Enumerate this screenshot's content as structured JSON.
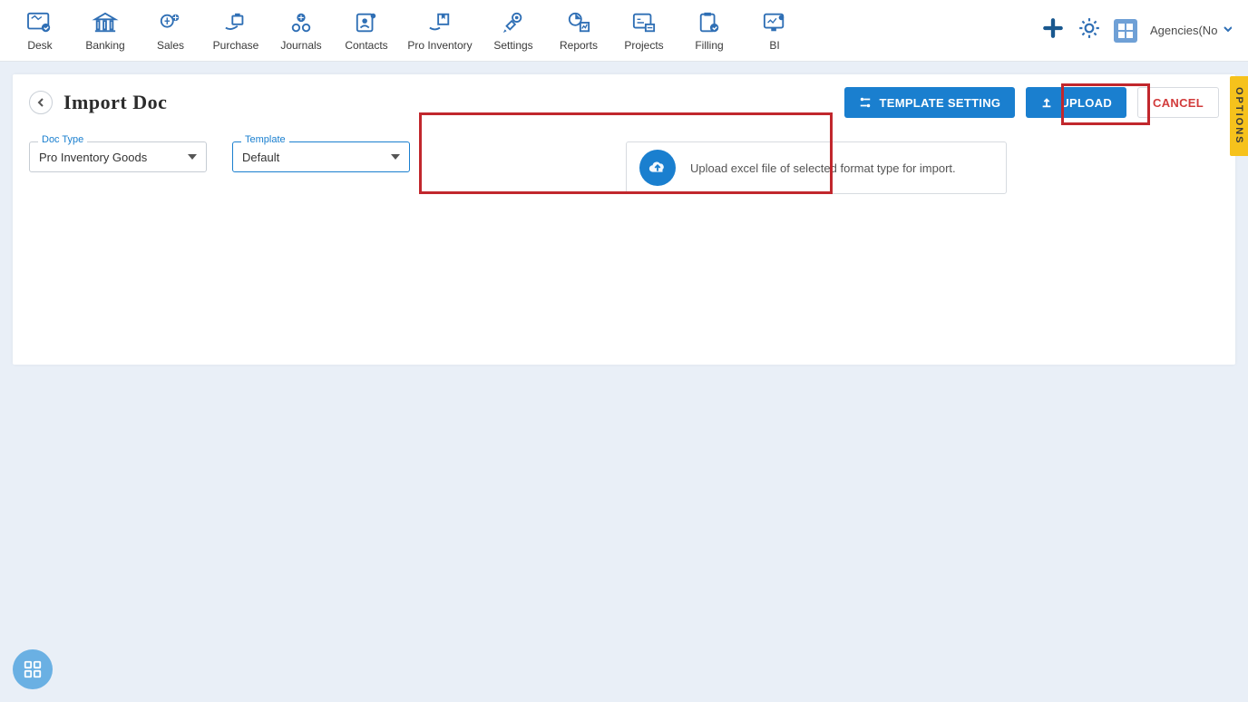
{
  "nav": {
    "items": [
      {
        "label": "Desk"
      },
      {
        "label": "Banking"
      },
      {
        "label": "Sales"
      },
      {
        "label": "Purchase"
      },
      {
        "label": "Journals"
      },
      {
        "label": "Contacts"
      },
      {
        "label": "Pro Inventory"
      },
      {
        "label": "Settings"
      },
      {
        "label": "Reports"
      },
      {
        "label": "Projects"
      },
      {
        "label": "Filling"
      },
      {
        "label": "BI"
      }
    ],
    "org": "Agencies(No"
  },
  "page": {
    "title": "Import Doc",
    "actions": {
      "template_setting": "TEMPLATE SETTING",
      "upload": "UPLOAD",
      "cancel": "CANCEL"
    }
  },
  "form": {
    "doc_type_label": "Doc Type",
    "doc_type_value": "Pro Inventory Goods",
    "template_label": "Template",
    "template_value": "Default"
  },
  "upload_panel": {
    "message": "Upload excel file of selected format type for import."
  },
  "options_tab": "OPTIONS"
}
